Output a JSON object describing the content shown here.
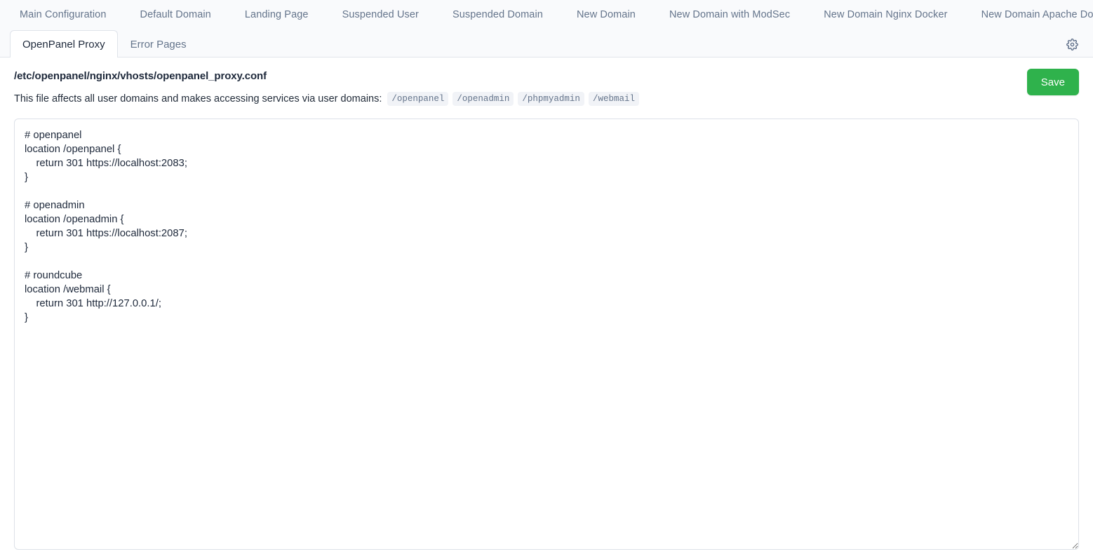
{
  "nav_primary": {
    "items": [
      {
        "label": "Main Configuration",
        "active": false
      },
      {
        "label": "Default Domain",
        "active": false
      },
      {
        "label": "Landing Page",
        "active": false
      },
      {
        "label": "Suspended User",
        "active": false
      },
      {
        "label": "Suspended Domain",
        "active": false
      },
      {
        "label": "New Domain",
        "active": false
      },
      {
        "label": "New Domain with ModSec",
        "active": false
      },
      {
        "label": "New Domain Nginx Docker",
        "active": false
      },
      {
        "label": "New Domain Apache Docker",
        "active": false
      }
    ]
  },
  "nav_secondary": {
    "items": [
      {
        "label": "OpenPanel Proxy",
        "active": true
      },
      {
        "label": "Error Pages",
        "active": false
      }
    ]
  },
  "settings": {
    "icon": "gear-icon"
  },
  "main": {
    "file_path": "/etc/openpanel/nginx/vhosts/openpanel_proxy.conf",
    "description": "This file affects all user domains and makes accessing services via user domains:",
    "chips": [
      "/openpanel",
      "/openadmin",
      "/phpmyadmin",
      "/webmail"
    ],
    "save_label": "Save",
    "editor_content": "# openpanel\nlocation /openpanel {\n    return 301 https://localhost:2083;\n}\n\n# openadmin\nlocation /openadmin {\n    return 301 https://localhost:2087;\n}\n\n# roundcube\nlocation /webmail {\n    return 301 http://127.0.0.1/;\n}"
  },
  "colors": {
    "accent_save": "#2fb24c",
    "topbar_bg": "#f9fafc",
    "text_muted": "#64748b",
    "text_dark": "#1e293b",
    "border": "#dde1e8"
  }
}
